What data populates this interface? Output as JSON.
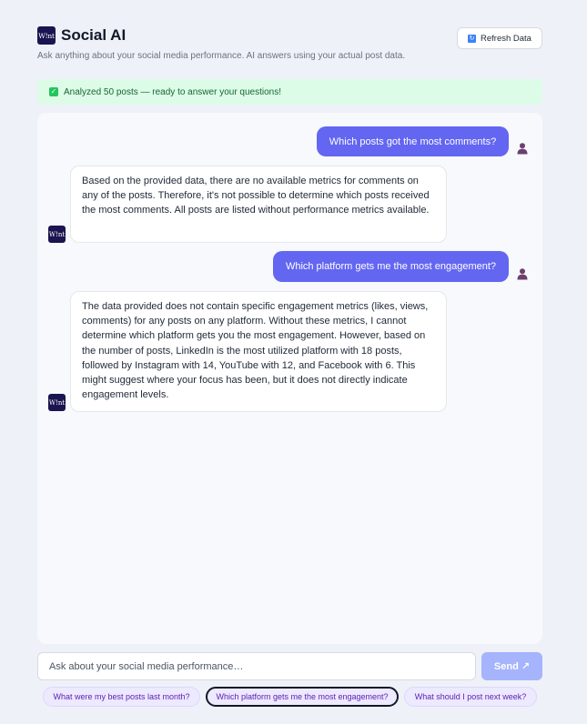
{
  "header": {
    "logo_text": "W!nt",
    "title": "Social AI",
    "subtitle": "Ask anything about your social media performance. AI answers using your actual post data.",
    "refresh_icon": "↻",
    "refresh_label": "Refresh Data"
  },
  "status": {
    "icon": "✓",
    "text": "Analyzed 50 posts — ready to answer your questions!"
  },
  "messages": [
    {
      "role": "user",
      "text": "Which posts got the most comments?"
    },
    {
      "role": "assistant",
      "avatar": "W!nt",
      "text": "Based on the provided data, there are no available metrics for comments on any of the posts. Therefore, it's not possible to determine which posts received the most comments. All posts are listed without performance metrics available."
    },
    {
      "role": "user",
      "text": "Which platform gets me the most engagement?"
    },
    {
      "role": "assistant",
      "avatar": "W!nt",
      "text": "The data provided does not contain specific engagement metrics (likes, views, comments) for any posts on any platform. Without these metrics, I cannot determine which platform gets you the most engagement. However, based on the number of posts, LinkedIn is the most utilized platform with 18 posts, followed by Instagram with 14, YouTube with 12, and Facebook with 6. This might suggest where your focus has been, but it does not directly indicate engagement levels."
    }
  ],
  "composer": {
    "placeholder": "Ask about your social media performance…",
    "send_label": "Send ↗"
  },
  "suggestions": [
    {
      "label": "What were my best posts last month?",
      "active": false
    },
    {
      "label": "Which platform gets me the most engagement?",
      "active": true
    },
    {
      "label": "What should I post next week?",
      "active": false
    }
  ],
  "colors": {
    "accent": "#6366f1",
    "send_disabled": "#a5b4fc",
    "status_bg": "#dcfce7",
    "chip_bg": "#ede9fe"
  }
}
